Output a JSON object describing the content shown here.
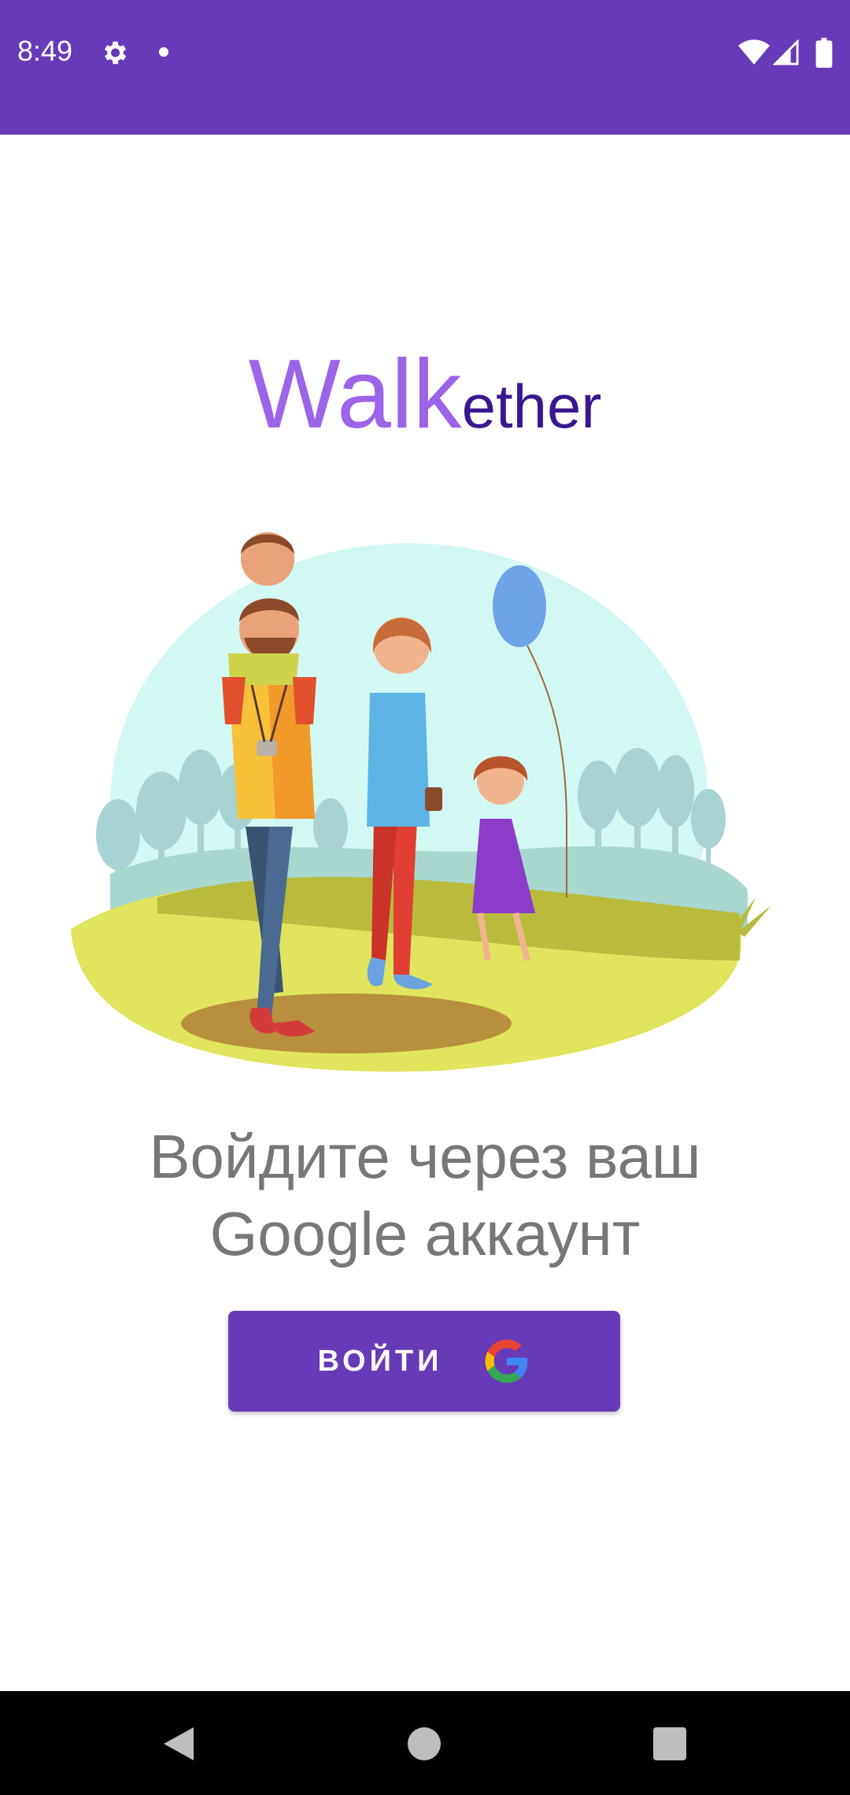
{
  "status_bar": {
    "time": "8:49",
    "icons": [
      "gear-icon",
      "notification-dot-icon",
      "wifi-icon",
      "signal-icon",
      "battery-icon"
    ]
  },
  "app": {
    "title_part1": "Walk",
    "title_part2": "ether"
  },
  "login": {
    "prompt_line1": "Войдите через ваш",
    "prompt_line2": "Google аккаунт",
    "button_label": "ВОЙТИ",
    "button_icon": "google-icon"
  },
  "colors": {
    "primary": "#673ab7",
    "title_light": "#9c64e8",
    "title_dark": "#3a1791",
    "text_gray": "#777777"
  },
  "nav_bar": {
    "icons": [
      "back-icon",
      "home-icon",
      "recents-icon"
    ]
  }
}
